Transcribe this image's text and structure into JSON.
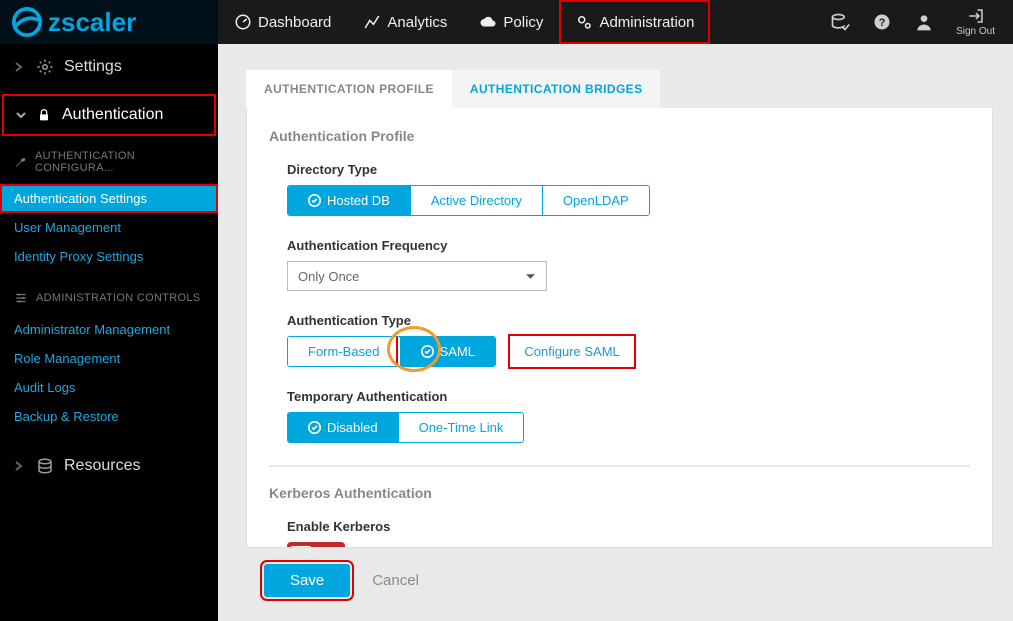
{
  "brand": {
    "name": "zscaler"
  },
  "topnav": {
    "items": [
      {
        "label": "Dashboard"
      },
      {
        "label": "Analytics"
      },
      {
        "label": "Policy"
      },
      {
        "label": "Administration"
      }
    ],
    "signout_label": "Sign Out"
  },
  "sidebar": {
    "settings_label": "Settings",
    "auth_label": "Authentication",
    "auth_config_group": "AUTHENTICATION CONFIGURA...",
    "auth_links": [
      {
        "label": "Authentication Settings",
        "active": true
      },
      {
        "label": "User Management"
      },
      {
        "label": "Identity Proxy Settings"
      }
    ],
    "admin_controls_group": "ADMINISTRATION CONTROLS",
    "admin_links": [
      {
        "label": "Administrator Management"
      },
      {
        "label": "Role Management"
      },
      {
        "label": "Audit Logs"
      },
      {
        "label": "Backup & Restore"
      }
    ],
    "resources_label": "Resources"
  },
  "tabs": {
    "profile": "AUTHENTICATION PROFILE",
    "bridges": "AUTHENTICATION BRIDGES"
  },
  "profile": {
    "heading": "Authentication Profile",
    "directory_type": {
      "label": "Directory Type",
      "options": [
        "Hosted DB",
        "Active Directory",
        "OpenLDAP"
      ],
      "selected": "Hosted DB"
    },
    "auth_frequency": {
      "label": "Authentication Frequency",
      "value": "Only Once"
    },
    "auth_type": {
      "label": "Authentication Type",
      "options": [
        "Form-Based",
        "SAML"
      ],
      "selected": "SAML",
      "configure_link": "Configure SAML"
    },
    "temp_auth": {
      "label": "Temporary Authentication",
      "options": [
        "Disabled",
        "One-Time Link"
      ],
      "selected": "Disabled"
    },
    "kerberos": {
      "heading": "Kerberos Authentication",
      "label": "Enable Kerberos",
      "enabled": false
    }
  },
  "footer": {
    "save": "Save",
    "cancel": "Cancel"
  }
}
